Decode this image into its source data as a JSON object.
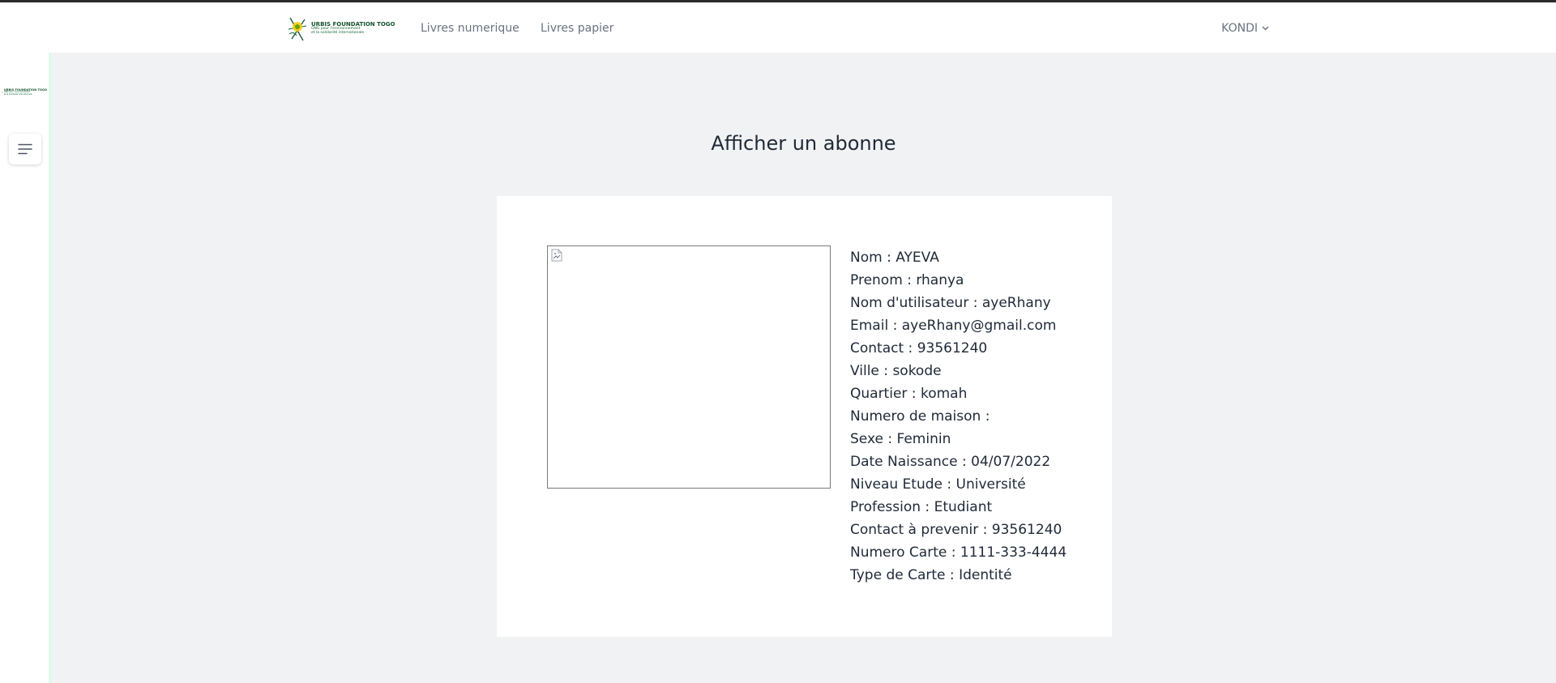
{
  "header": {
    "brand": {
      "name": "URBIS FOUNDATION TOGO",
      "tagline_line1": "ONG pour l'environnement",
      "tagline_line2": "et la solidarité internationale"
    },
    "nav": [
      {
        "label": "Livres numerique"
      },
      {
        "label": "Livres papier"
      }
    ],
    "user": {
      "label": "KONDI",
      "icon": "chevron-down-icon"
    }
  },
  "sidebar": {
    "logo": {
      "name": "URBIS FOUNDATION TOGO",
      "tagline_line1": "ONG pour l'environnement",
      "tagline_line2": "et la solidarité internationale"
    },
    "menu_icon": "hamburger-menu-icon"
  },
  "main": {
    "title": "Afficher un abonne",
    "photo_icon": "broken-image-icon",
    "details": [
      {
        "label": "Nom",
        "value": "AYEVA"
      },
      {
        "label": "Prenom",
        "value": "rhanya"
      },
      {
        "label": "Nom d'utilisateur",
        "value": "ayeRhany"
      },
      {
        "label": "Email",
        "value": "ayeRhany@gmail.com"
      },
      {
        "label": "Contact",
        "value": "93561240"
      },
      {
        "label": "Ville",
        "value": "sokode"
      },
      {
        "label": "Quartier",
        "value": "komah"
      },
      {
        "label": "Numero de maison",
        "value": ""
      },
      {
        "label": "Sexe",
        "value": "Feminin"
      },
      {
        "label": "Date Naissance",
        "value": "04/07/2022"
      },
      {
        "label": "Niveau Etude",
        "value": "Université"
      },
      {
        "label": "Profession",
        "value": "Etudiant"
      },
      {
        "label": "Contact à prevenir",
        "value": "93561240"
      },
      {
        "label": "Numero Carte",
        "value": "1111-333-4444"
      },
      {
        "label": "Type de Carte",
        "value": "Identité"
      }
    ]
  },
  "colors": {
    "brand_green": "#14532d",
    "sidebar_accent": "#dcfce7",
    "main_background": "#f1f2f4"
  }
}
